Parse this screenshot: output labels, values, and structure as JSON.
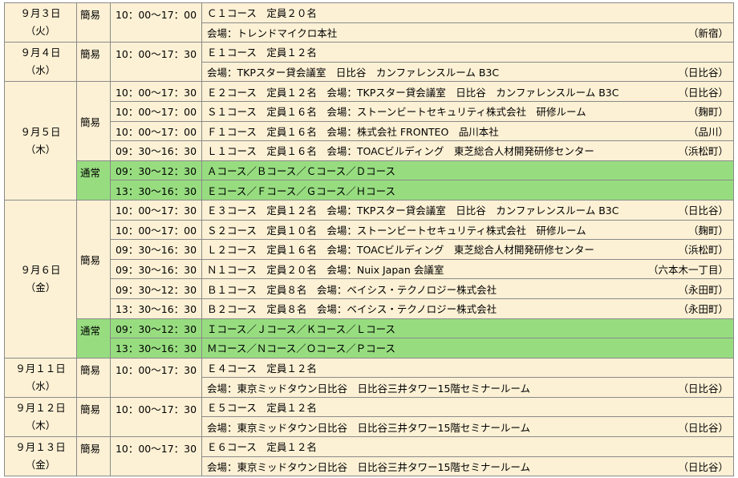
{
  "schedule": {
    "blocks": [
      {
        "date": "９月３日",
        "weekday": "（火）",
        "groups": [
          {
            "type": "簡易",
            "green": false,
            "sessions": [
              {
                "time": "10：00～17：00",
                "lines": [
                  {
                    "text": "Ｃ１コース　定員２０名",
                    "loc": ""
                  },
                  {
                    "text": "会場：トレンドマイクロ本社",
                    "loc": "（新宿）"
                  }
                ]
              }
            ]
          }
        ]
      },
      {
        "date": "９月４日",
        "weekday": "（水）",
        "groups": [
          {
            "type": "簡易",
            "green": false,
            "sessions": [
              {
                "time": "10：00～17：30",
                "lines": [
                  {
                    "text": "Ｅ１コース　定員１２名",
                    "loc": ""
                  },
                  {
                    "text": "会場：TKPスター貸会議室　日比谷　カンファレンスルーム B3C",
                    "loc": "（日比谷）"
                  }
                ]
              }
            ]
          }
        ]
      },
      {
        "date": "９月５日",
        "weekday": "（木）",
        "groups": [
          {
            "type": "簡易",
            "green": false,
            "sessions": [
              {
                "time": "10：00～17：30",
                "lines": [
                  {
                    "text": "Ｅ２コース　定員１２名　会場：TKPスター貸会議室　日比谷　カンファレンスルーム B3C",
                    "loc": "（日比谷）"
                  }
                ]
              },
              {
                "time": "10：00～17：00",
                "lines": [
                  {
                    "text": "Ｓ１コース　定員１６名　会場：ストーンビートセキュリティ株式会社　研修ルーム",
                    "loc": "（麹町）"
                  }
                ]
              },
              {
                "time": "10：00～17：00",
                "lines": [
                  {
                    "text": "Ｆ１コース　定員１６名　会場：株式会社 FRONTEO　品川本社",
                    "loc": "（品川）"
                  }
                ]
              },
              {
                "time": "09：30～16：30",
                "lines": [
                  {
                    "text": "Ｌ１コース　定員１６名　会場：TOACビルディング　東芝総合人材開発研修センター",
                    "loc": "（浜松町）"
                  }
                ]
              }
            ]
          },
          {
            "type": "通常",
            "green": true,
            "sessions": [
              {
                "time": "09：30～12：30",
                "lines": [
                  {
                    "text": "Ａコース／Ｂコース／Ｃコース／Ｄコース",
                    "loc": ""
                  }
                ]
              },
              {
                "time": "13：30～16：30",
                "lines": [
                  {
                    "text": "Ｅコース／Ｆコース／Ｇコース／Ｈコース",
                    "loc": ""
                  }
                ]
              }
            ]
          }
        ]
      },
      {
        "date": "９月６日",
        "weekday": "（金）",
        "groups": [
          {
            "type": "簡易",
            "green": false,
            "sessions": [
              {
                "time": "10：00～17：30",
                "lines": [
                  {
                    "text": "Ｅ３コース　定員１２名　会場：TKPスター貸会議室　日比谷　カンファレンスルーム B3C",
                    "loc": "（日比谷）"
                  }
                ]
              },
              {
                "time": "10：00～17：00",
                "lines": [
                  {
                    "text": "Ｓ２コース　定員１０名　会場：ストーンビートセキュリティ株式会社　研修ルーム",
                    "loc": "（麹町）"
                  }
                ]
              },
              {
                "time": "09：30～16：30",
                "lines": [
                  {
                    "text": "Ｌ２コース　定員１６名　会場：TOACビルディング　東芝総合人材開発研修センター",
                    "loc": "（浜松町）"
                  }
                ]
              },
              {
                "time": "09：30～16：30",
                "lines": [
                  {
                    "text": "Ｎ１コース　定員２０名　会場：Nuix Japan 会議室",
                    "loc": "（六本木一丁目）"
                  }
                ]
              },
              {
                "time": "09：30～12：30",
                "lines": [
                  {
                    "text": "Ｂ１コース　定員８名　会場：ベイシス・テクノロジー株式会社",
                    "loc": "（永田町）"
                  }
                ]
              },
              {
                "time": "13：30～16：30",
                "lines": [
                  {
                    "text": "Ｂ２コース　定員８名　会場：ベイシス・テクノロジー株式会社",
                    "loc": "（永田町）"
                  }
                ]
              }
            ]
          },
          {
            "type": "通常",
            "green": true,
            "sessions": [
              {
                "time": "09：30～12：30",
                "lines": [
                  {
                    "text": "Ｉコース／Ｊコース／Ｋコース／Ｌコース",
                    "loc": ""
                  }
                ]
              },
              {
                "time": "13：30～16：30",
                "lines": [
                  {
                    "text": "Ｍコース／Ｎコース／Ｏコース／Ｐコース",
                    "loc": ""
                  }
                ]
              }
            ]
          }
        ]
      },
      {
        "date": "９月１１日",
        "weekday": "（水）",
        "groups": [
          {
            "type": "簡易",
            "green": false,
            "sessions": [
              {
                "time": "10：00～17：30",
                "lines": [
                  {
                    "text": "Ｅ４コース　定員１２名",
                    "loc": ""
                  },
                  {
                    "text": "会場：東京ミッドタウン日比谷　日比谷三井タワー15階セミナールーム",
                    "loc": "（日比谷）"
                  }
                ]
              }
            ]
          }
        ]
      },
      {
        "date": "９月１２日",
        "weekday": "（木）",
        "groups": [
          {
            "type": "簡易",
            "green": false,
            "sessions": [
              {
                "time": "10：00～17：30",
                "lines": [
                  {
                    "text": "Ｅ５コース　定員１２名",
                    "loc": ""
                  },
                  {
                    "text": "会場：東京ミッドタウン日比谷　日比谷三井タワー15階セミナールーム",
                    "loc": "（日比谷）"
                  }
                ]
              }
            ]
          }
        ]
      },
      {
        "date": "９月１３日",
        "weekday": "（金）",
        "groups": [
          {
            "type": "簡易",
            "green": false,
            "sessions": [
              {
                "time": "10：00～17：30",
                "lines": [
                  {
                    "text": "Ｅ６コース　定員１２名",
                    "loc": ""
                  },
                  {
                    "text": "会場：東京ミッドタウン日比谷　日比谷三井タワー15階セミナールーム",
                    "loc": "（日比谷）"
                  }
                ]
              }
            ]
          }
        ]
      }
    ]
  }
}
